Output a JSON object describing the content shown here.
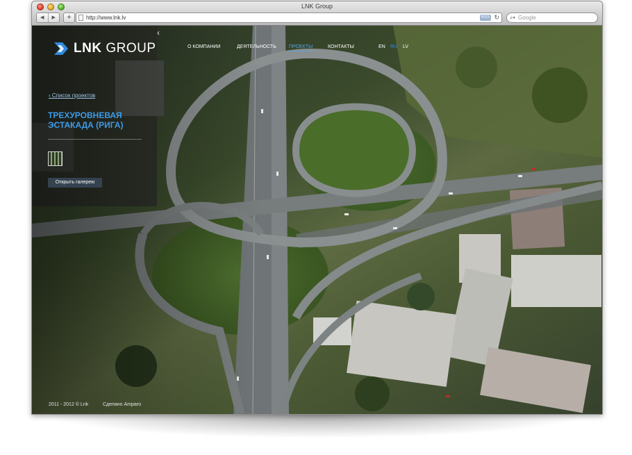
{
  "browser": {
    "title": "LNK Group",
    "url": "http://www.lnk.lv",
    "rss_label": "RSS",
    "search_placeholder": "Google"
  },
  "site": {
    "logo_text_bold": "LNK",
    "logo_text_thin": " GROUP",
    "nav": [
      {
        "label": "О КОМПАНИИ",
        "active": false
      },
      {
        "label": "ДЕЯТЕЛЬНОСТЬ",
        "active": false
      },
      {
        "label": "ПРОЕКТЫ",
        "active": true
      },
      {
        "label": "КОНТАКТЫ",
        "active": false
      }
    ],
    "languages": [
      {
        "code": "EN",
        "active": false
      },
      {
        "code": "RU",
        "active": true
      },
      {
        "code": "LV",
        "active": false
      }
    ],
    "breadcrumb": "‹ Список проектов",
    "project_title": "ТРЕХУРОВНЕВАЯ ЭСТАКАДА (РИГА)",
    "gallery_button": "Открыть галерею",
    "footer_copyright": "2011 - 2012 © Lnk",
    "footer_made": "Сделано Amparo"
  },
  "colors": {
    "accent": "#3d9be9",
    "nav_active": "#5aa3e0",
    "button_bg": "#374655"
  }
}
